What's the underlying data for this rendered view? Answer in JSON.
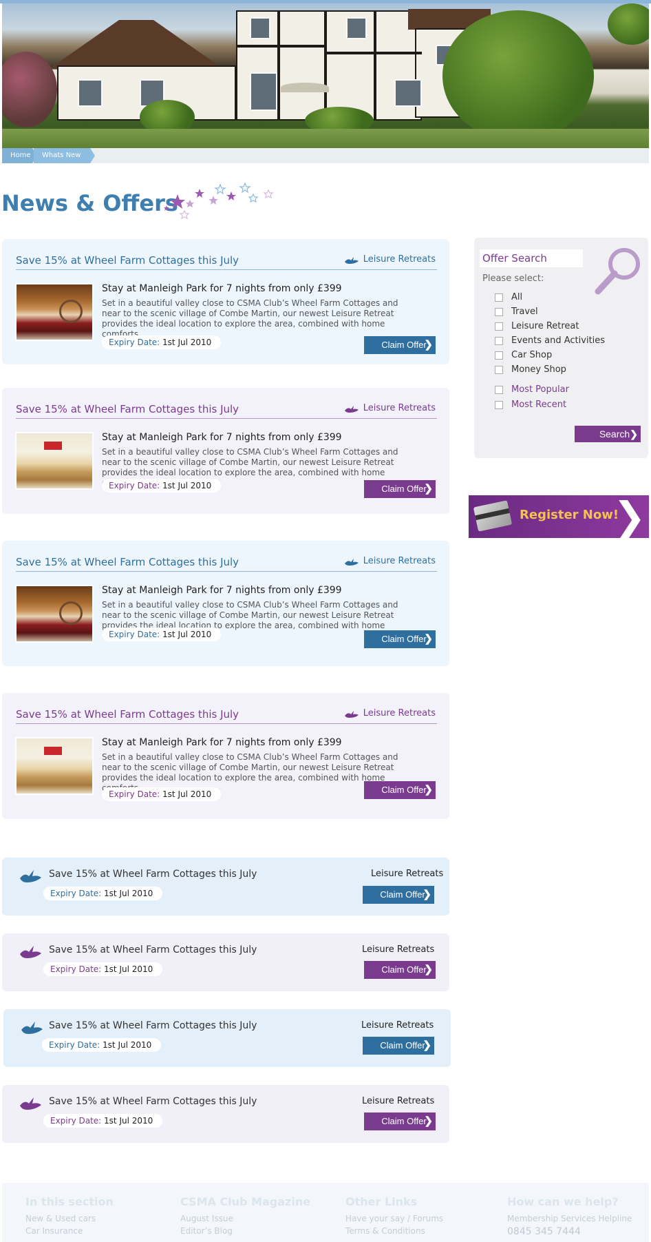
{
  "breadcrumb": [
    "Home",
    "Whats New"
  ],
  "page_title": "News & Offers",
  "offers": [
    {
      "title": "Save 15% at Wheel Farm Cottages this July",
      "category": "Leisure Retreats",
      "headline": "Stay at Manleigh Park for 7 nights from only £399",
      "description": "Set in a beautiful valley close to CSMA Club’s Wheel Farm Cottages and near to the scenic village of Combe Martin, our newest Leisure Retreat provides the ideal location to explore the area, combined with home comforts.",
      "expiry_label": "Expiry Date:",
      "expiry_date": "1st Jul 2010",
      "claim_label": "Claim Offer"
    },
    {
      "title": "Save 15% at Wheel Farm Cottages this July",
      "category": "Leisure Retreats",
      "headline": "Stay at Manleigh Park for 7 nights from only £399",
      "description": "Set in a beautiful valley close to CSMA Club’s Wheel Farm Cottages and near to the scenic village of Combe Martin, our newest Leisure Retreat provides the ideal location to explore the area, combined with home comforts.",
      "expiry_label": "Expiry Date:",
      "expiry_date": "1st Jul 2010",
      "claim_label": "Claim Offer"
    },
    {
      "title": "Save 15% at Wheel Farm Cottages this July",
      "category": "Leisure Retreats",
      "headline": "Stay at Manleigh Park for 7 nights from only £399",
      "description": "Set in a beautiful valley close to CSMA Club’s Wheel Farm Cottages and near to the scenic village of Combe Martin, our newest Leisure Retreat provides the ideal location to explore the area, combined with home comforts.",
      "expiry_label": "Expiry Date:",
      "expiry_date": "1st Jul 2010",
      "claim_label": "Claim Offer"
    },
    {
      "title": "Save 15% at Wheel Farm Cottages this July",
      "category": "Leisure Retreats",
      "headline": "Stay at Manleigh Park for 7 nights from only £399",
      "description": "Set in a beautiful valley close to CSMA Club’s Wheel Farm Cottages and near to the scenic village of Combe Martin, our newest Leisure Retreat provides the ideal location to explore the area, combined with home comforts.",
      "expiry_label": "Expiry Date:",
      "expiry_date": "1st Jul 2010",
      "claim_label": "Claim Offer"
    }
  ],
  "compact_offers": [
    {
      "title": "Save 15% at Wheel Farm Cottages this July",
      "category": "Leisure Retreats",
      "expiry_label": "Expiry Date:",
      "expiry_date": "1st Jul 2010",
      "claim_label": "Claim Offer"
    },
    {
      "title": "Save 15% at Wheel Farm Cottages this July",
      "category": "Leisure Retreats",
      "expiry_label": "Expiry Date:",
      "expiry_date": "1st Jul 2010",
      "claim_label": "Claim Offer"
    },
    {
      "title": "Save 15% at Wheel Farm Cottages this July",
      "category": "Leisure Retreats",
      "expiry_label": "Expiry Date:",
      "expiry_date": "1st Jul 2010",
      "claim_label": "Claim Offer"
    },
    {
      "title": "Save 15% at Wheel Farm Cottages this July",
      "category": "Leisure Retreats",
      "expiry_label": "Expiry Date:",
      "expiry_date": "1st Jul 2010",
      "claim_label": "Claim Offer"
    }
  ],
  "offer_search": {
    "title": "Offer Search",
    "prompt": "Please select:",
    "options": [
      "All",
      "Travel",
      "Leisure Retreat",
      "Events and Activities",
      "Car Shop",
      "Money Shop"
    ],
    "sort_options": [
      "Most Popular",
      "Most Recent"
    ],
    "search_label": "Search"
  },
  "register": {
    "label": "Register Now!"
  },
  "footer": {
    "columns": [
      {
        "heading": "In this section",
        "links": [
          "New & Used cars",
          "Car Insurance"
        ]
      },
      {
        "heading": "CSMA Club Magazine",
        "links": [
          "August Issue",
          "Editor’s Blog"
        ]
      },
      {
        "heading": "Other Links",
        "links": [
          "Have your say / Forums",
          "Terms & Conditions"
        ]
      },
      {
        "heading": "How can we help?",
        "links": [
          "Membership Services Helpline"
        ],
        "phone": "0845 345 7444"
      }
    ]
  },
  "colors": {
    "blue": "#2f6f9f",
    "purple": "#7a3b8e",
    "title_blue": "#3e7fb0",
    "register_text": "#f5c24d"
  },
  "icons": [
    "bird-icon",
    "magnifier-icon",
    "membership-card-icon",
    "stars-decoration"
  ]
}
